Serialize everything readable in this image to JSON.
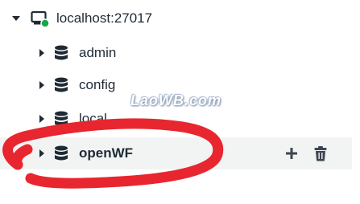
{
  "connection": {
    "host": "localhost:27017",
    "status_color": "#1aa64b",
    "icon": "server-icon"
  },
  "databases": [
    {
      "name": "admin",
      "icon": "database-icon",
      "selected": false
    },
    {
      "name": "config",
      "icon": "database-icon",
      "selected": false
    },
    {
      "name": "local",
      "icon": "database-icon",
      "selected": false
    },
    {
      "name": "openWF",
      "icon": "database-icon",
      "selected": true
    }
  ],
  "actions": {
    "add_icon": "plus-icon",
    "delete_icon": "trash-icon"
  },
  "watermark": {
    "text": "LaoWB.com"
  },
  "annotation": {
    "color": "#e8262f",
    "shape": "red-scribble-circle"
  },
  "colors": {
    "text": "#1f2a35",
    "selected_bg": "#f2f3f3",
    "icon": "#1f2a35"
  }
}
